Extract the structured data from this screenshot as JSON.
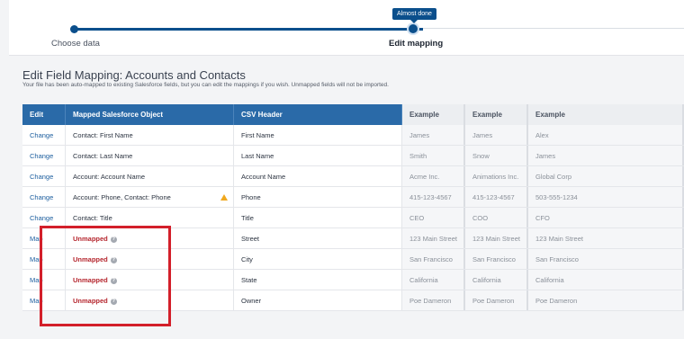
{
  "progress": {
    "badge": "Almost done",
    "steps": [
      {
        "label": "Choose data"
      },
      {
        "label": "Edit mapping"
      }
    ]
  },
  "page": {
    "title": "Edit Field Mapping: Accounts and Contacts",
    "subtitle": "Your file has been auto-mapped to existing Salesforce fields, but you can edit the mappings if you wish. Unmapped fields will not be imported."
  },
  "table": {
    "headers": {
      "edit": "Edit",
      "object": "Mapped Salesforce Object",
      "csv": "CSV Header",
      "ex1": "Example",
      "ex2": "Example",
      "ex3": "Example"
    },
    "rows": [
      {
        "edit": "Change",
        "object": "Contact: First Name",
        "csv": "First Name",
        "ex1": "James",
        "ex2": "James",
        "ex3": "Alex"
      },
      {
        "edit": "Change",
        "object": "Contact: Last Name",
        "csv": "Last Name",
        "ex1": "Smith",
        "ex2": "Snow",
        "ex3": "James"
      },
      {
        "edit": "Change",
        "object": "Account: Account Name",
        "csv": "Account Name",
        "ex1": "Acme Inc.",
        "ex2": "Animations Inc.",
        "ex3": "Global Corp"
      },
      {
        "edit": "Change",
        "object": "Account: Phone, Contact: Phone",
        "csv": "Phone",
        "ex1": "415-123-4567",
        "ex2": "415-123-4567",
        "ex3": "503-555-1234"
      },
      {
        "edit": "Change",
        "object": "Contact: Title",
        "csv": "Title",
        "ex1": "CEO",
        "ex2": "COO",
        "ex3": "CFO"
      },
      {
        "edit": "Map",
        "object": "Unmapped",
        "csv": "Street",
        "ex1": "123 Main Street",
        "ex2": "123 Main Street",
        "ex3": "123 Main Street"
      },
      {
        "edit": "Map",
        "object": "Unmapped",
        "csv": "City",
        "ex1": "San Francisco",
        "ex2": "San Francisco",
        "ex3": "San Francisco"
      },
      {
        "edit": "Map",
        "object": "Unmapped",
        "csv": "State",
        "ex1": "California",
        "ex2": "California",
        "ex3": "California"
      },
      {
        "edit": "Map",
        "object": "Unmapped",
        "csv": "Owner",
        "ex1": "Poe Dameron",
        "ex2": "Poe Dameron",
        "ex3": "Poe Dameron"
      }
    ],
    "help_glyph": "?"
  },
  "colors": {
    "header_blue": "#2a6aa8",
    "progress_blue": "#0b4f8c",
    "unmapped_red": "#b5262e",
    "highlight_red": "#d31f2a",
    "warning": "#f0a81e"
  }
}
